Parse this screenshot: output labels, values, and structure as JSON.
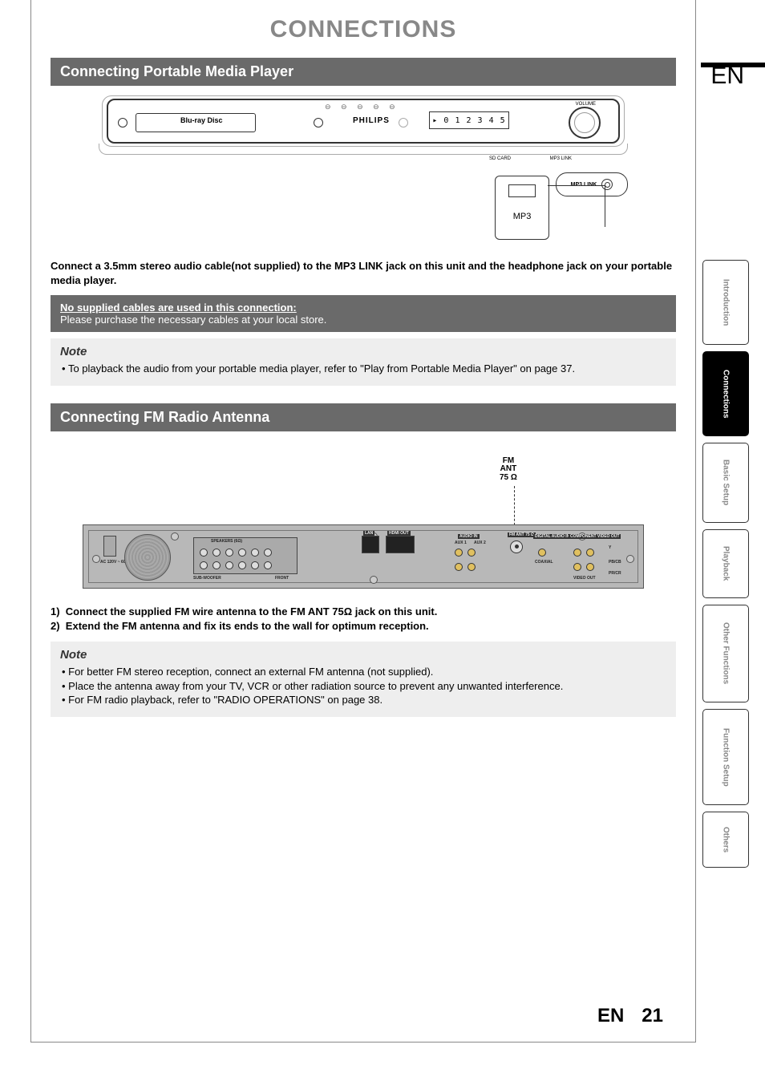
{
  "page": {
    "title": "CONNECTIONS",
    "lang_mark": "EN",
    "footer_lang": "EN",
    "footer_page": "21"
  },
  "tabs": {
    "intro": "Introduction",
    "connections": "Connections",
    "basic": "Basic Setup",
    "playback": "Playback",
    "other_functions": "Other Functions",
    "function_setup": "Function Setup",
    "others": "Others"
  },
  "section1": {
    "header": "Connecting Portable Media Player",
    "device": {
      "brand": "PHILIPS",
      "bluray": "Blu-ray Disc",
      "display": "▸ 0 1 2 3 4 5",
      "volume": "VOLUME",
      "sd_card": "SD CARD",
      "mp3_link_small": "MP3 LINK"
    },
    "callout": "MP3 LINK",
    "mp3_label": "MP3",
    "instruction": "Connect a 3.5mm stereo audio cable(not supplied) to the MP3 LINK jack on this unit and the headphone jack on your portable media player.",
    "supplied_title": "No supplied cables are used in this connection:",
    "supplied_body": "Please purchase the necessary cables at your local store.",
    "note_title": "Note",
    "note_items": [
      "To playback the audio from your portable media player, refer to \"Play from Portable Media Player\" on page 37."
    ]
  },
  "section2": {
    "header": "Connecting FM Radio Antenna",
    "fm_label_1": "FM",
    "fm_label_2": "ANT",
    "fm_label_3": "75 Ω",
    "rear_labels": {
      "speakers": "SPEAKERS (6Ω)",
      "lan": "LAN",
      "hdmi": "HDMI OUT",
      "audio_in": "AUDIO IN",
      "aux1": "AUX 1",
      "aux2": "AUX 2",
      "fm_ant": "FM ANT 75 Ω",
      "digital_audio_in": "DIGITAL AUDIO IN",
      "coaxial": "COAXIAL",
      "component": "COMPONENT VIDEO OUT",
      "video_out": "VIDEO OUT",
      "sub": "SUB-WOOFER",
      "front": "FRONT",
      "ac": "AC 120V ~ 60Hz",
      "y": "Y",
      "pb": "PB/CB",
      "pr": "PR/CR"
    },
    "steps": [
      "Connect the supplied FM wire antenna to the FM ANT 75Ω jack on this unit.",
      "Extend the FM antenna and fix its ends to the wall for optimum reception."
    ],
    "note_title": "Note",
    "note_items": [
      "For better FM stereo reception, connect an external FM antenna (not supplied).",
      "Place the antenna away from your TV, VCR or other radiation source to prevent any unwanted interference.",
      "For FM radio playback, refer to \"RADIO OPERATIONS\" on page 38."
    ]
  }
}
